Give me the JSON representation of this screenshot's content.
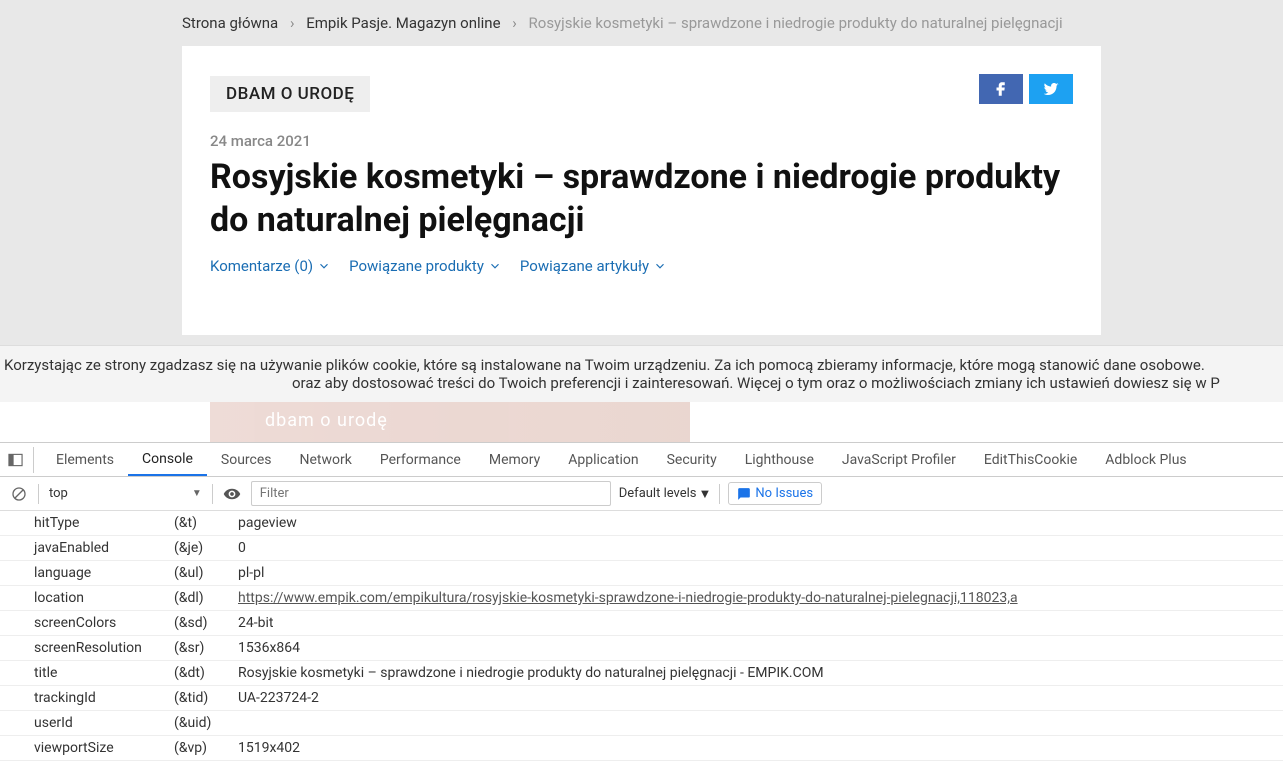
{
  "breadcrumb": {
    "home": "Strona główna",
    "mid": "Empik Pasje. Magazyn online",
    "current": "Rosyjskie kosmetyki – sprawdzone i niedrogie produkty do naturalnej pielęgnacji"
  },
  "article": {
    "category": "DBAM O URODĘ",
    "date": "24 marca 2021",
    "title": "Rosyjskie kosmetyki – sprawdzone i niedrogie produkty do naturalnej pielęgnacji",
    "comments": "Komentarze (0)",
    "related_products": "Powiązane produkty",
    "related_articles": "Powiązane artykuły",
    "blur_label": "dbam o urodę"
  },
  "cookie": {
    "line1": "Korzystając ze strony zgadzasz się na używanie plików cookie, które są instalowane na Twoim urządzeniu. Za ich pomocą zbieramy informacje, które mogą stanowić dane osobowe.",
    "line2": "oraz aby dostosować treści do Twoich preferencji i zainteresowań. Więcej o tym oraz o możliwościach zmiany ich ustawień dowiesz się w P"
  },
  "devtools": {
    "tabs": [
      "Elements",
      "Console",
      "Sources",
      "Network",
      "Performance",
      "Memory",
      "Application",
      "Security",
      "Lighthouse",
      "JavaScript Profiler",
      "EditThisCookie",
      "Adblock Plus"
    ],
    "active_tab": "Console",
    "context": "top",
    "filter_placeholder": "Filter",
    "levels": "Default levels",
    "issues": "No Issues",
    "rows": [
      {
        "k": "hitType",
        "p": "(&t)",
        "v": "pageview"
      },
      {
        "k": "javaEnabled",
        "p": "(&je)",
        "v": "0"
      },
      {
        "k": "language",
        "p": "(&ul)",
        "v": "pl-pl"
      },
      {
        "k": "location",
        "p": "(&dl)",
        "v": "https://www.empik.com/empikultura/rosyjskie-kosmetyki-sprawdzone-i-niedrogie-produkty-do-naturalnej-pielegnacji,118023,a",
        "link": true
      },
      {
        "k": "screenColors",
        "p": "(&sd)",
        "v": "24-bit"
      },
      {
        "k": "screenResolution",
        "p": "(&sr)",
        "v": "1536x864"
      },
      {
        "k": "title",
        "p": "(&dt)",
        "v": "Rosyjskie kosmetyki – sprawdzone i niedrogie produkty do naturalnej pielęgnacji - EMPIK.COM"
      },
      {
        "k": "trackingId",
        "p": "(&tid)",
        "v": "UA-223724-2"
      },
      {
        "k": "userId",
        "p": "(&uid)",
        "v": ""
      },
      {
        "k": "viewportSize",
        "p": "(&vp)",
        "v": "1519x402"
      }
    ]
  }
}
